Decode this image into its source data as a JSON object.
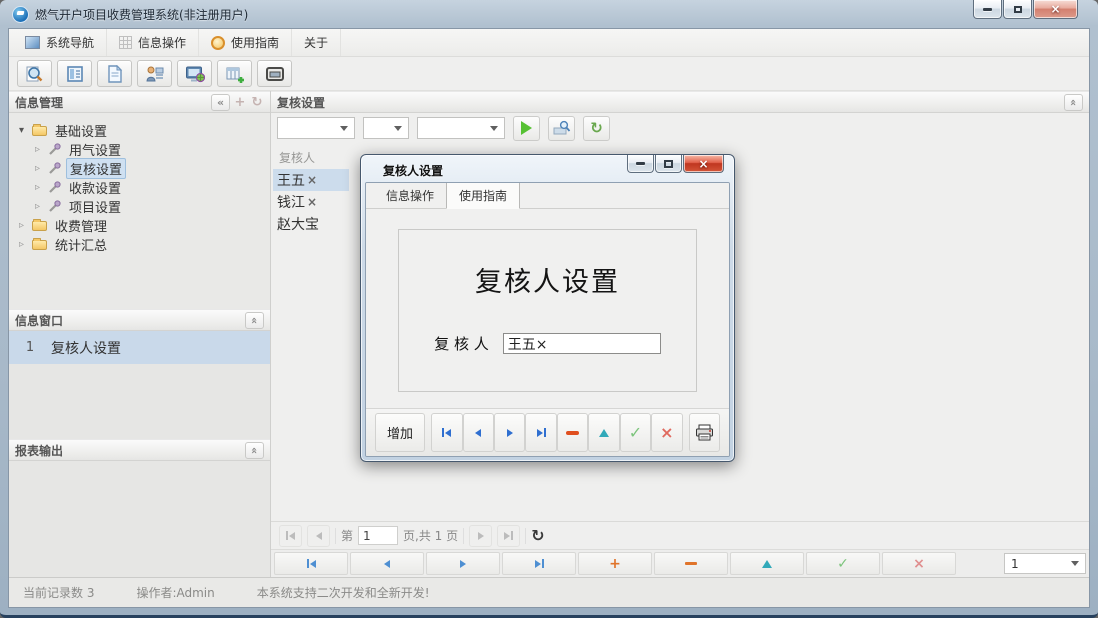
{
  "window": {
    "title": "燃气开户项目收费管理系统(非注册用户)"
  },
  "icons": {
    "collapse_left": "«",
    "collapse_up": "«",
    "plus": "+",
    "rotate": "↻",
    "expander_open": "▾",
    "expander_closed": "▹",
    "close_x": "×",
    "check": "✓"
  },
  "menu": {
    "items": [
      {
        "label": "系统导航"
      },
      {
        "label": "信息操作"
      },
      {
        "label": "使用指南"
      },
      {
        "label": "关于"
      }
    ]
  },
  "toolbar": {
    "buttons": [
      {
        "icon": "search-preview-icon"
      },
      {
        "icon": "form-view-icon"
      },
      {
        "icon": "new-document-icon"
      },
      {
        "icon": "user-config-icon"
      },
      {
        "icon": "monitor-globe-icon"
      },
      {
        "icon": "table-add-icon"
      },
      {
        "icon": "window-frame-icon"
      }
    ]
  },
  "sidebar": {
    "info_manage": {
      "title": "信息管理"
    },
    "tree": [
      {
        "label": "基础设置"
      },
      {
        "label": "用气设置"
      },
      {
        "label": "复核设置"
      },
      {
        "label": "收款设置"
      },
      {
        "label": "项目设置"
      },
      {
        "label": "收费管理"
      },
      {
        "label": "统计汇总"
      }
    ],
    "info_window": {
      "title": "信息窗口",
      "items": [
        {
          "index": "1",
          "label": "复核人设置"
        }
      ]
    },
    "report_output": {
      "title": "报表输出"
    }
  },
  "main": {
    "title": "复核设置",
    "list_header": "复核人",
    "list": [
      {
        "label": "王五",
        "close": "×"
      },
      {
        "label": "钱江",
        "close": "×"
      },
      {
        "label": "赵大宝",
        "close": ""
      }
    ],
    "pager": {
      "prefix": "第",
      "page": "1",
      "suffix": "页,共 1 页"
    },
    "record_select": "1"
  },
  "dialog": {
    "title": "复核人设置",
    "tabs": [
      {
        "label": "信息操作"
      },
      {
        "label": "使用指南"
      }
    ],
    "heading": "复核人设置",
    "field_label": "复 核 人",
    "field_value": "王五×",
    "add_button": "增加"
  },
  "statusbar": {
    "records": "当前记录数 3",
    "operator": "操作者:Admin",
    "message": "本系统支持二次开发和全新开发!"
  },
  "colors": {
    "selection_blue": "#cfe0f1",
    "row_selection": "#c9d9ea",
    "dialog_close_red": "#d14c31",
    "accent_blue": "#2f6fd0",
    "play_green": "#56c133"
  }
}
